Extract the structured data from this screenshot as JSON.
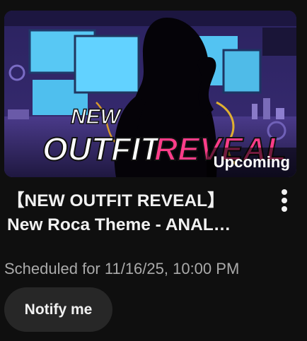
{
  "video": {
    "badge": "Upcoming",
    "title_line1": "【NEW OUTFIT REVEAL】",
    "title_line2": "New Roca Theme - ANAL…",
    "scheduled": "Scheduled for 11/16/25, 10:00 PM",
    "notify_label": "Notify me",
    "thumbnail_text": {
      "line1": "NEW",
      "line2_a": "OUTFIT",
      "line2_b": "REVEAL"
    }
  },
  "icons": {
    "menu": "more-vert-icon"
  },
  "colors": {
    "background": "#0f0f0f",
    "notify_bg": "#272727",
    "meta_text": "#aaaaaa",
    "reveal_pink": "#ff3d8a"
  }
}
